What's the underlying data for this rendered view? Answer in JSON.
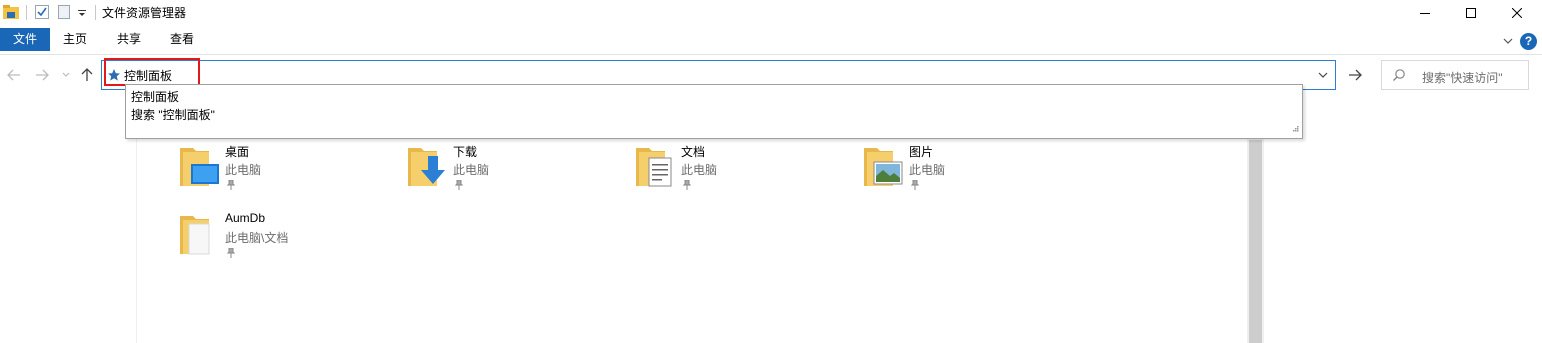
{
  "window": {
    "title": "文件资源管理器",
    "minimize_icon": "minimize-icon",
    "maximize_icon": "maximize-icon",
    "close_icon": "close-icon"
  },
  "ribbon": {
    "tabs": [
      {
        "label": "文件"
      },
      {
        "label": "主页"
      },
      {
        "label": "共享"
      },
      {
        "label": "查看"
      }
    ],
    "help_label": "?"
  },
  "address": {
    "value": "控制面板"
  },
  "search": {
    "placeholder": "搜索\"快速访问\""
  },
  "autocomplete": {
    "items": [
      {
        "label": "控制面板"
      },
      {
        "label": "搜索 \"控制面板\""
      }
    ]
  },
  "quick_access": {
    "items": [
      {
        "name": "桌面",
        "location": "此电脑",
        "icon": "desktop-folder-icon"
      },
      {
        "name": "下载",
        "location": "此电脑",
        "icon": "downloads-folder-icon"
      },
      {
        "name": "文档",
        "location": "此电脑",
        "icon": "documents-folder-icon"
      },
      {
        "name": "图片",
        "location": "此电脑",
        "icon": "pictures-folder-icon"
      },
      {
        "name": "AumDb",
        "location": "此电脑\\文档",
        "icon": "folder-icon"
      }
    ]
  },
  "colors": {
    "accent": "#1a67b8",
    "highlight": "#e01a1a",
    "folder": "#f5cf6b"
  }
}
